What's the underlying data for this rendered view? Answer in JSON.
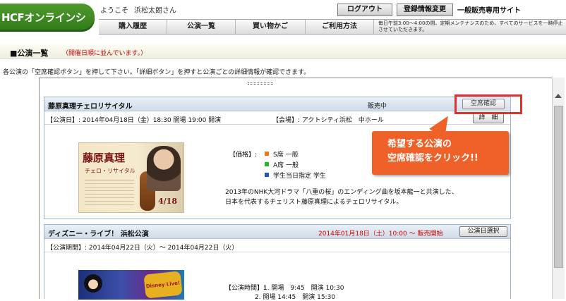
{
  "header": {
    "logo_text": "HCFオンラインショップ",
    "welcome": "ようこそ",
    "username": "浜松太朗さん",
    "logout_label": "ログアウト",
    "registration_label": "登録情報変更",
    "site_type": "一般販売専用サイト"
  },
  "nav": {
    "items": [
      {
        "label": "購入履歴"
      },
      {
        "label": "公演一覧"
      },
      {
        "label": "買い物かご"
      },
      {
        "label": "ご利用方法"
      }
    ],
    "notice": "毎日午前3:00〜4:00の間、定期メンテナンスのため、すべてのサービスを一時停止させていただきます。"
  },
  "page": {
    "title": "■公演一覧",
    "sort_note": "（開催日順に並んでいます。）",
    "instruction": "各公演の「空席確認ボタン」を押して下さい。「詳細ボタン」を押すと公演ごとの詳細情報が確認できます。"
  },
  "events": [
    {
      "title": "藤原真理チェロリサイタル",
      "status": "販売中",
      "seat_check_label": "空席確認",
      "detail_label": "詳　細",
      "date_text": "【公演日】: 2014年04月18日（金）18:30 開場 19:00 開演",
      "venue_text": "【会場】: アクトシティ浜松　中ホール",
      "price_label": "【価格】:",
      "prices": [
        {
          "label": "S席 一般",
          "color": "#f07a10"
        },
        {
          "label": "A席 一般",
          "color": "#28b428"
        },
        {
          "label": "学生当日指定 学生",
          "color": "#2850c8"
        }
      ],
      "description_lines": [
        "2013年のNHK大河ドラマ「八重の桜」のエンディング曲を坂本龍一と共演した、",
        "日本を代表するチェリスト藤原真理によるチェロリサイタル。"
      ],
      "poster": {
        "name": "藤原真理",
        "subtitle": "チェロ・リサイタル",
        "date": "4/18"
      }
    },
    {
      "title": "ディズニー・ライブ！ 浜松公演",
      "status": "2014年01月18日（土）10:00 〜 販売開始",
      "status_color": "#d40000",
      "select_label": "公演日選択",
      "period_text": "【公演期間】: 2014年04月22日（火）〜 2014年04月22日（火）",
      "time_label": "【公演時間】:",
      "times": [
        "1. 開場　9:45　開演 10:30",
        "2. 開場 14:45　開演 15:30"
      ],
      "poster": {
        "logo_text": "Disney Live!"
      }
    }
  ],
  "callout": {
    "line1": "希望する公演の",
    "line2": "空席確認をクリック!!",
    "color": "#ef6128",
    "highlight_color": "#e03030"
  }
}
